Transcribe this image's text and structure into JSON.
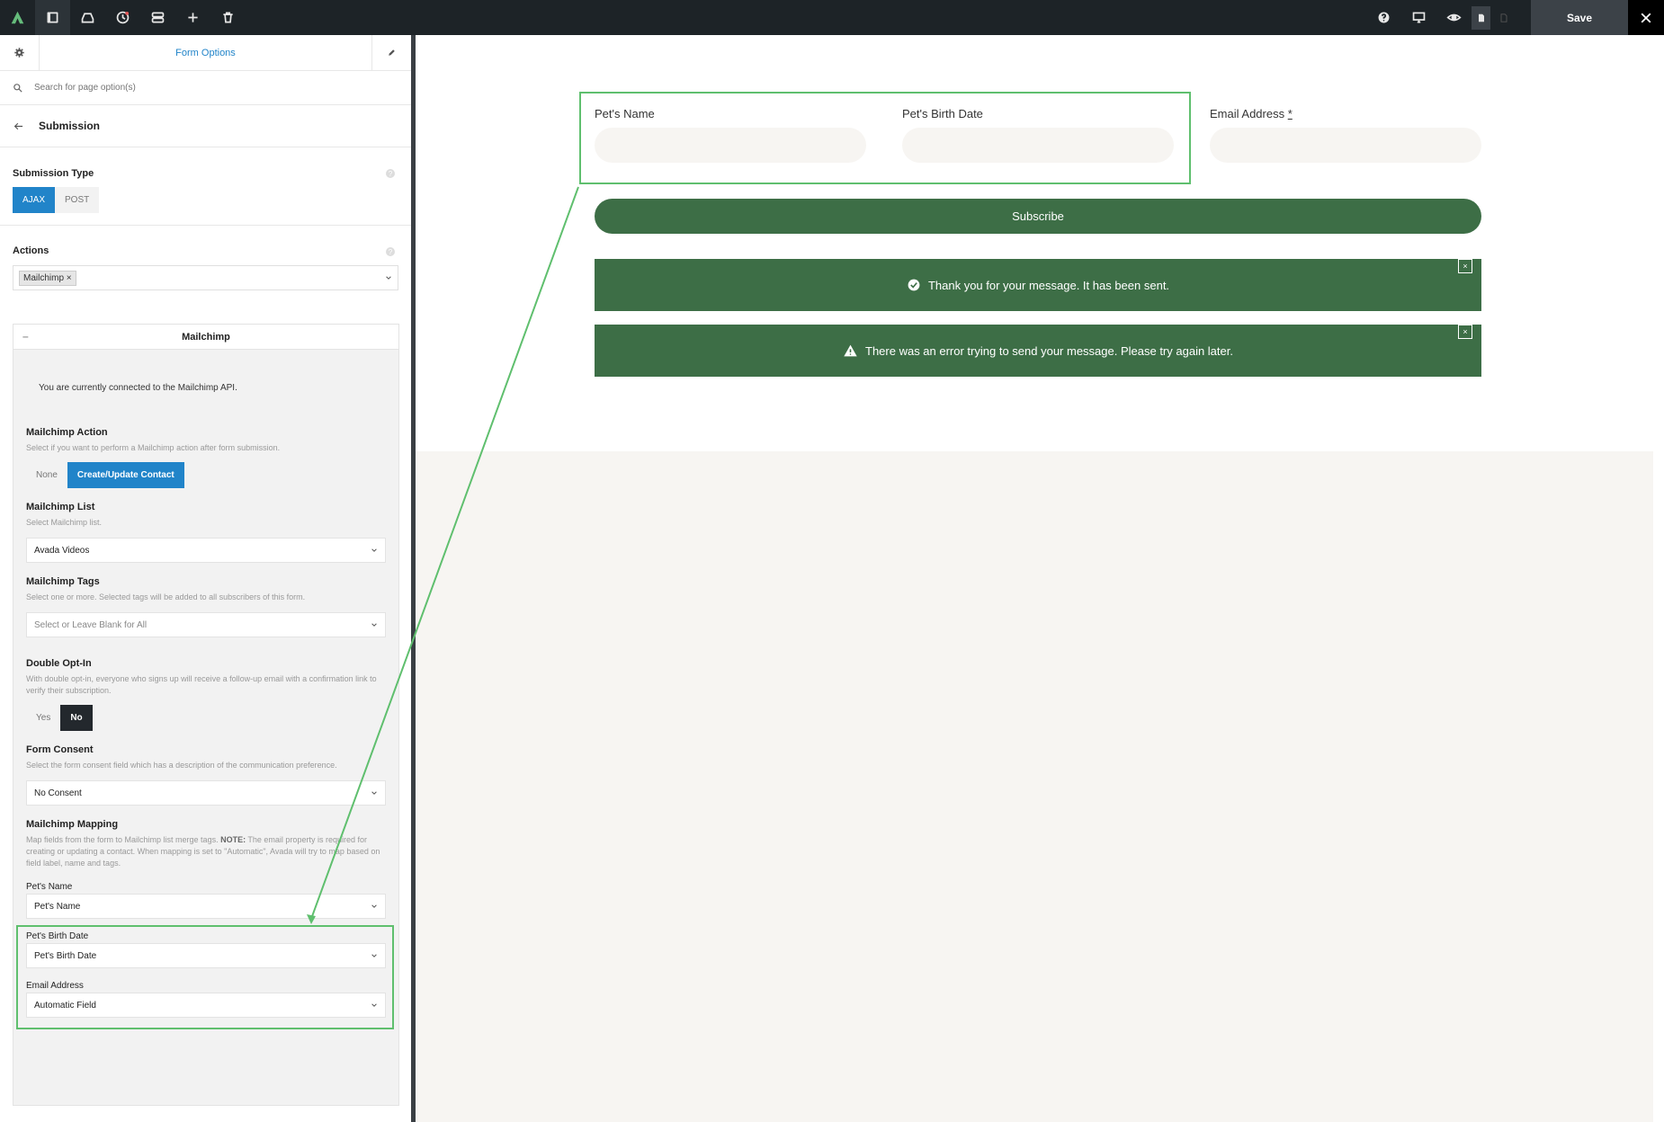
{
  "topbar": {
    "save_label": "Save",
    "left_icons": [
      "avada-logo-icon",
      "sidebar-toggle-icon",
      "library-icon",
      "history-icon",
      "navigator-icon",
      "add-icon",
      "trash-icon"
    ],
    "right_icons": [
      "help-icon",
      "desktop-preview-icon",
      "preview-eye-icon",
      "page-icon",
      "close-icon"
    ]
  },
  "sidebar": {
    "header_title": "Form Options",
    "search_placeholder": "Search for page option(s)",
    "section_title": "Submission",
    "submission_type": {
      "label": "Submission Type",
      "options": [
        "AJAX",
        "POST"
      ],
      "selected": "AJAX"
    },
    "actions": {
      "label": "Actions",
      "tags": [
        "Mailchimp"
      ]
    },
    "mailchimp": {
      "title": "Mailchimp",
      "connected_text": "You are currently connected to the Mailchimp API.",
      "action": {
        "label": "Mailchimp Action",
        "desc": "Select if you want to perform a Mailchimp action after form submission.",
        "options": [
          "None",
          "Create/Update Contact"
        ],
        "selected": "Create/Update Contact"
      },
      "list": {
        "label": "Mailchimp List",
        "desc": "Select Mailchimp list.",
        "value": "Avada Videos"
      },
      "tags": {
        "label": "Mailchimp Tags",
        "desc": "Select one or more. Selected tags will be added to all subscribers of this form.",
        "placeholder": "Select or Leave Blank for All"
      },
      "double_optin": {
        "label": "Double Opt-In",
        "desc": "With double opt-in, everyone who signs up will receive a follow-up email with a confirmation link to verify their subscription.",
        "options": [
          "Yes",
          "No"
        ],
        "selected": "No"
      },
      "consent": {
        "label": "Form Consent",
        "desc": "Select the form consent field which has a description of the communication preference.",
        "value": "No Consent"
      },
      "mapping": {
        "label": "Mailchimp Mapping",
        "desc_prefix": "Map fields from the form to Mailchimp list merge tags. ",
        "desc_note": "NOTE:",
        "desc_suffix": " The email property is required for creating or updating a contact. When mapping is set to \"Automatic\", Avada will try to map based on field label, name and tags.",
        "fields": [
          {
            "label": "Pet's Name",
            "value": "Pet's Name"
          },
          {
            "label": "Pet's Birth Date",
            "value": "Pet's Birth Date"
          },
          {
            "label": "Email Address",
            "value": "Automatic Field"
          }
        ]
      }
    }
  },
  "form": {
    "fields": [
      {
        "label": "Pet's Name"
      },
      {
        "label": "Pet's Birth Date"
      },
      {
        "label": "Email Address",
        "required_mark": "*"
      }
    ],
    "submit_label": "Subscribe",
    "success_message": "Thank you for your message. It has been sent.",
    "error_message": "There was an error trying to send your message. Please try again later.",
    "dismiss_label": "×"
  },
  "colors": {
    "accent": "#2184c9",
    "brand_green": "#3d6e46",
    "highlight": "#5fbf6e",
    "topbar": "#1d2327"
  }
}
